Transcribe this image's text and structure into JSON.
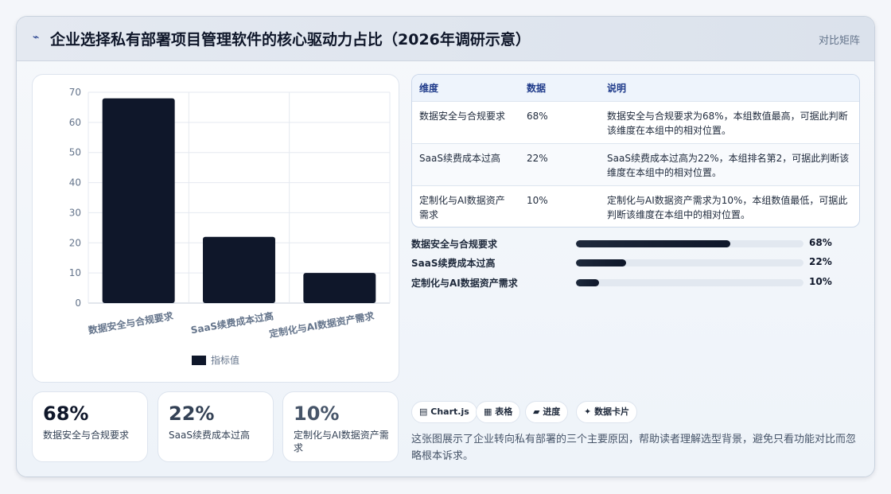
{
  "header": {
    "icon": "⌁",
    "title": "企业选择私有部署项目管理软件的核心驱动力占比（2026年调研示意）",
    "tag": "对比矩阵"
  },
  "chart_data": {
    "type": "bar",
    "categories": [
      "数据安全与合规要求",
      "SaaS续费成本过高",
      "定制化与AI数据资产需求"
    ],
    "series": [
      {
        "name": "指标值",
        "values": [
          68,
          22,
          10
        ],
        "color": "#0f172a"
      }
    ],
    "ylim": [
      0,
      70
    ],
    "yticks": [
      0,
      10,
      20,
      30,
      40,
      50,
      60,
      70
    ],
    "grid": true,
    "legend": "bottom"
  },
  "stats": [
    {
      "value": "68%",
      "label": "数据安全与合规要求",
      "color": "#0f172a"
    },
    {
      "value": "22%",
      "label": "SaaS续费成本过高",
      "color": "#334155"
    },
    {
      "value": "10%",
      "label": "定制化与AI数据资产需求",
      "color": "#475569"
    }
  ],
  "table": {
    "headers": [
      "维度",
      "数据",
      "说明"
    ],
    "rows": [
      [
        "数据安全与合规要求",
        "68%",
        "数据安全与合规要求为68%，本组数值最高，可据此判断该维度在本组中的相对位置。"
      ],
      [
        "SaaS续费成本过高",
        "22%",
        "SaaS续费成本过高为22%，本组排名第2，可据此判断该维度在本组中的相对位置。"
      ],
      [
        "定制化与AI数据资产需求",
        "10%",
        "定制化与AI数据资产需求为10%，本组数值最低，可据此判断该维度在本组中的相对位置。"
      ]
    ]
  },
  "progress": [
    {
      "label": "数据安全与合规要求",
      "value": 68,
      "text": "68%"
    },
    {
      "label": "SaaS续费成本过高",
      "value": 22,
      "text": "22%"
    },
    {
      "label": "定制化与AI数据资产需求",
      "value": 10,
      "text": "10%"
    }
  ],
  "chips": [
    {
      "icon": "▤",
      "label": "Chart.js"
    },
    {
      "icon": "▦",
      "label": "表格"
    },
    {
      "icon": "▰",
      "label": "进度"
    },
    {
      "icon": "✦",
      "label": "数据卡片"
    }
  ],
  "summary": "这张图展示了企业转向私有部署的三个主要原因，帮助读者理解选型背景，避免只看功能对比而忽略根本诉求。"
}
